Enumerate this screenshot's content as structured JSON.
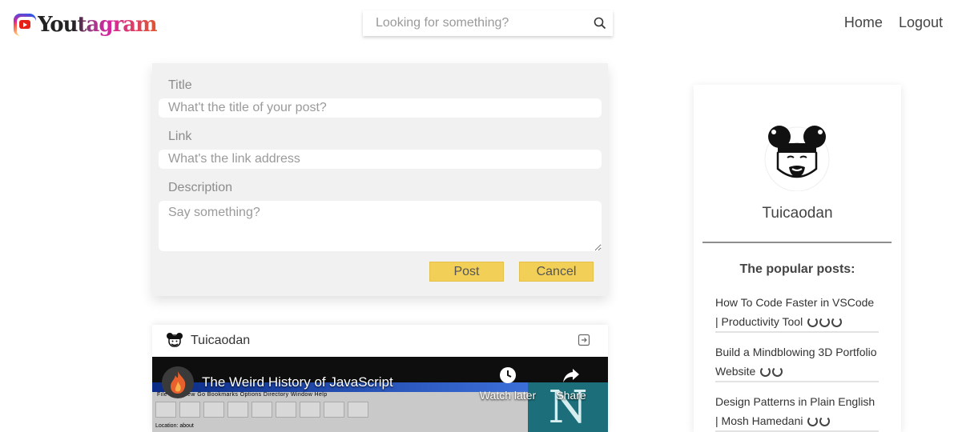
{
  "header": {
    "logo_text": "Youtagram",
    "search_placeholder": "Looking for something?",
    "nav": [
      "Home",
      "Logout"
    ]
  },
  "post_form": {
    "title_label": "Title",
    "title_placeholder": "What't the title of your post?",
    "link_label": "Link",
    "link_placeholder": "What's the link address",
    "description_label": "Description",
    "description_placeholder": "Say something?",
    "post_button": "Post",
    "cancel_button": "Cancel"
  },
  "feed": {
    "post_author": "Tuicaodan",
    "video": {
      "title": "The Weird History of JavaScript",
      "watch_later": "Watch later",
      "share": "Share",
      "browser_menu": "File  Edit  View  Go  Bookmarks  Options  Directory  Window  Help",
      "browser_location": "Location: about"
    }
  },
  "profile": {
    "username": "Tuicaodan",
    "popular_title": "The popular posts:",
    "popular_posts": [
      {
        "title": "How To Code Faster in VSCode | Productivity Tool",
        "spinners": 3
      },
      {
        "title": "Build a Mindblowing 3D Portfolio Website",
        "spinners": 2
      },
      {
        "title": "Design Patterns in Plain English | Mosh Hamedani",
        "spinners": 2
      }
    ]
  },
  "colors": {
    "button_yellow": "#f2cf56",
    "form_bg": "#f1f1f1",
    "divider": "#8e8e8e"
  }
}
